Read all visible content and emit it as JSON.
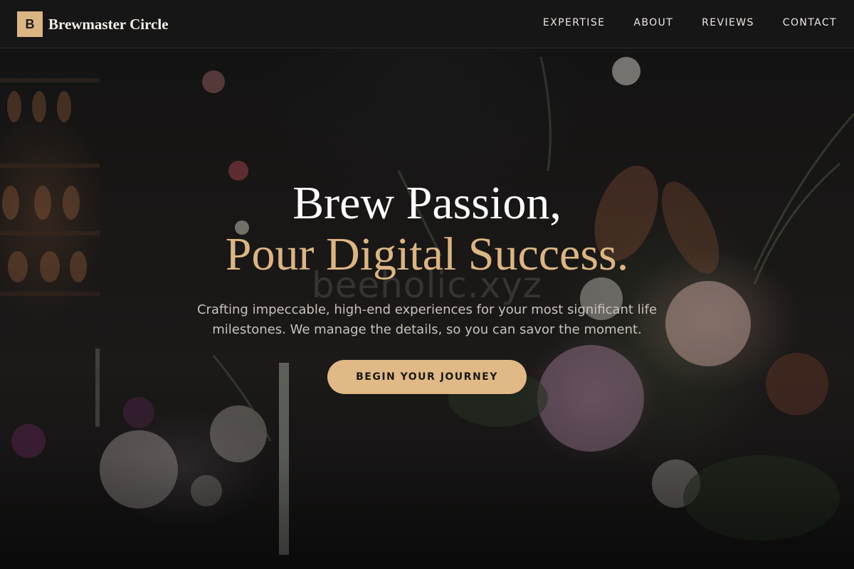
{
  "brand": {
    "mark": "B",
    "name": "Brewmaster Circle",
    "accent": "#dcb584"
  },
  "nav": {
    "items": [
      {
        "label": "EXPERTISE"
      },
      {
        "label": "ABOUT"
      },
      {
        "label": "REVIEWS"
      },
      {
        "label": "CONTACT"
      }
    ]
  },
  "hero": {
    "headline_line1": "Brew Passion,",
    "headline_line2": "Pour Digital Success.",
    "subtext": "Crafting impeccable, high-end experiences for your most significant life milestones. We manage the details, so you can savor the moment.",
    "cta_label": "BEGIN YOUR JOURNEY",
    "watermark": "beeholic.xyz"
  },
  "colors": {
    "header_bg": "#181717",
    "headline_white": "#ffffff",
    "headline_gold": "#dcb584",
    "cta_bg": "#e0b986"
  }
}
